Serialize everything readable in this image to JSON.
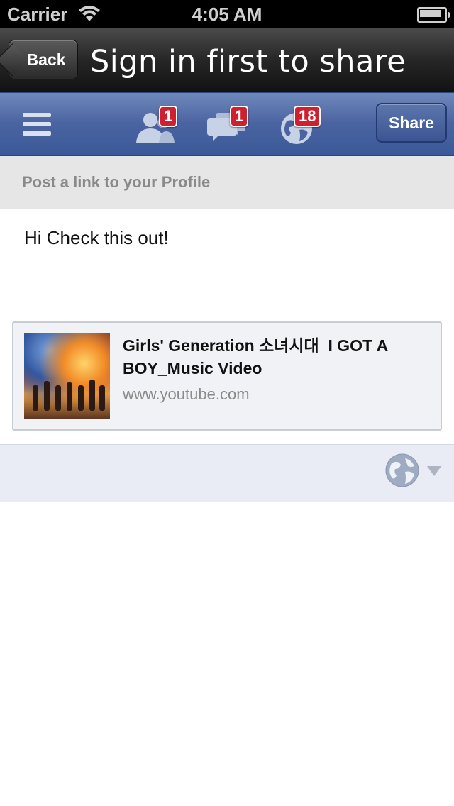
{
  "status_bar": {
    "carrier": "Carrier",
    "time": "4:05 AM"
  },
  "nav_bar": {
    "back_label": "Back",
    "title": "Sign in first to share"
  },
  "fb_bar": {
    "friend_requests_count": "1",
    "messages_count": "1",
    "notifications_count": "18",
    "share_label": "Share",
    "background_color": "#3b5998"
  },
  "composer": {
    "header": "Post a link to your Profile",
    "message": "Hi Check this out!"
  },
  "link_preview": {
    "title": "Girls' Generation 소녀시대_I GOT A BOY_Music Video",
    "domain": "www.youtube.com"
  },
  "audience": {
    "icon": "globe-icon"
  }
}
